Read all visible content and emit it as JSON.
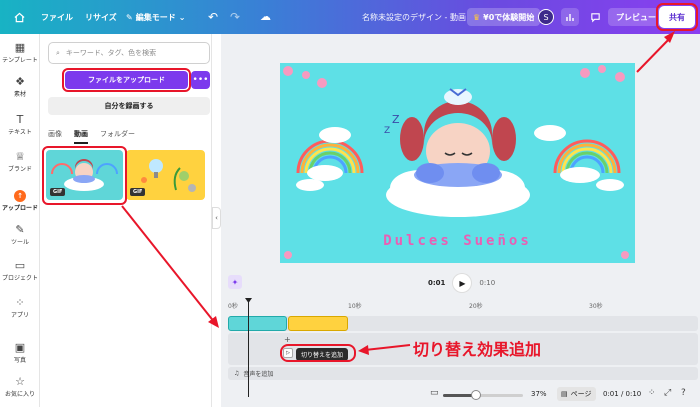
{
  "topbar": {
    "file_label": "ファイル",
    "resize_label": "リサイズ",
    "edit_mode_label": "編集モード",
    "title": "名称未設定のデザイン - 動画",
    "trial_label": "¥0で体験開始",
    "avatar_initial": "S",
    "preview_label": "プレビュー",
    "share_label": "共有"
  },
  "rail": {
    "items": [
      {
        "label": "テンプレート",
        "icon": "template-icon"
      },
      {
        "label": "素材",
        "icon": "elements-icon"
      },
      {
        "label": "テキスト",
        "icon": "text-icon"
      },
      {
        "label": "ブランド",
        "icon": "brand-icon"
      },
      {
        "label": "アップロード",
        "icon": "upload-icon"
      },
      {
        "label": "ツール",
        "icon": "tools-icon"
      },
      {
        "label": "プロジェクト",
        "icon": "folder-icon"
      },
      {
        "label": "アプリ",
        "icon": "apps-icon"
      },
      {
        "label": "写真",
        "icon": "photo-icon"
      },
      {
        "label": "お気に入り",
        "icon": "star-icon"
      }
    ]
  },
  "panel": {
    "search_placeholder": "キーワード、タグ、色を検索",
    "upload_label": "ファイルをアップロード",
    "more_label": "•••",
    "record_label": "自分を録画する",
    "tabs": [
      "画像",
      "動画",
      "フォルダー"
    ],
    "gif_badge": "GIF"
  },
  "canvas": {
    "title_text": "Dulces Sueños",
    "bg_color": "#5ee0e6",
    "title_color": "#e95fb4"
  },
  "player": {
    "current": "0:01",
    "total": "0:10"
  },
  "timeline": {
    "ticks": [
      "0秒",
      "10秒",
      "20秒",
      "30秒"
    ],
    "transition_label": "切り替えを追加",
    "add_audio_label": "音声を追加"
  },
  "annotation": {
    "text": "切り替え効果追加"
  },
  "status": {
    "zoom": "37%",
    "zoom_fraction": 0.37,
    "page_label": "ページ",
    "page_count": "0:01 / 0:10"
  },
  "colors": {
    "accent": "#7c3aed",
    "annotation_red": "#e8162a"
  }
}
